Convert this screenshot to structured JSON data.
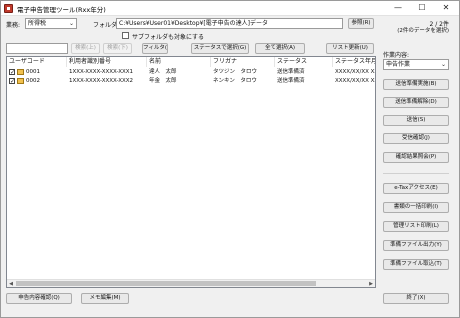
{
  "window": {
    "title": "電子申告管理ツール(Rxx年分)",
    "controls": {
      "minimize": "—",
      "maximize": "☐",
      "close": "✕"
    }
  },
  "toolbar": {
    "office_label": "業務:",
    "office_value": "所得税",
    "folder_label": "フォルダ:",
    "folder_path": "C:¥Users¥User01¥Desktop¥[電子申告の達人]データ",
    "browse_button": "参照(R)",
    "subfolder_checkbox": "サブフォルダも対象にする",
    "count_line1": "2 / 2件",
    "count_line2": "(2件のデータを選択)"
  },
  "search": {
    "input_value": "",
    "prev_button": "検索(上)",
    "next_button": "検索(下)",
    "filter_button": "フィルタ(Z)",
    "select_by_status_button": "ステータスで選択(G)",
    "select_all_button": "全て選択(A)",
    "refresh_button": "リスト更新(U)"
  },
  "table": {
    "columns": [
      "ユーザコード",
      "利用者識別番号",
      "名前",
      "フリガナ",
      "ステータス",
      "ステータス年月"
    ],
    "rows": [
      {
        "checked": true,
        "code": "0001",
        "user_id": "1XXX-XXXX-XXXX-XXX1",
        "name": "達人　太郎",
        "kana": "タツジン　タロウ",
        "status": "送信準備済",
        "status_date": "XXXX/XX/XX XX"
      },
      {
        "checked": true,
        "code": "0002",
        "user_id": "1XXX-XXXX-XXXX-XXX2",
        "name": "年金　太郎",
        "kana": "ネンキン　タロウ",
        "status": "送信準備済",
        "status_date": "XXXX/XX/XX XX"
      }
    ],
    "scroll_left": "◀",
    "scroll_right": "▶"
  },
  "sidebar": {
    "work_label": "作業内容:",
    "work_value": "申告作業",
    "buttons_group1": [
      "送信準備実施(B)",
      "送信準備解除(D)",
      "送信(S)",
      "受信確認(J)",
      "確認結果照会(P)"
    ],
    "buttons_group2": [
      "e-Taxアクセス(E)",
      "書類の一括印刷(I)",
      "管理リスト印刷(L)",
      "準備ファイル出力(Y)",
      "準備ファイル取込(T)"
    ]
  },
  "bottom": {
    "declaration_check_button": "申告内容確認(Q)",
    "memo_edit_button": "メモ編集(M)",
    "exit_button": "終了(X)"
  }
}
